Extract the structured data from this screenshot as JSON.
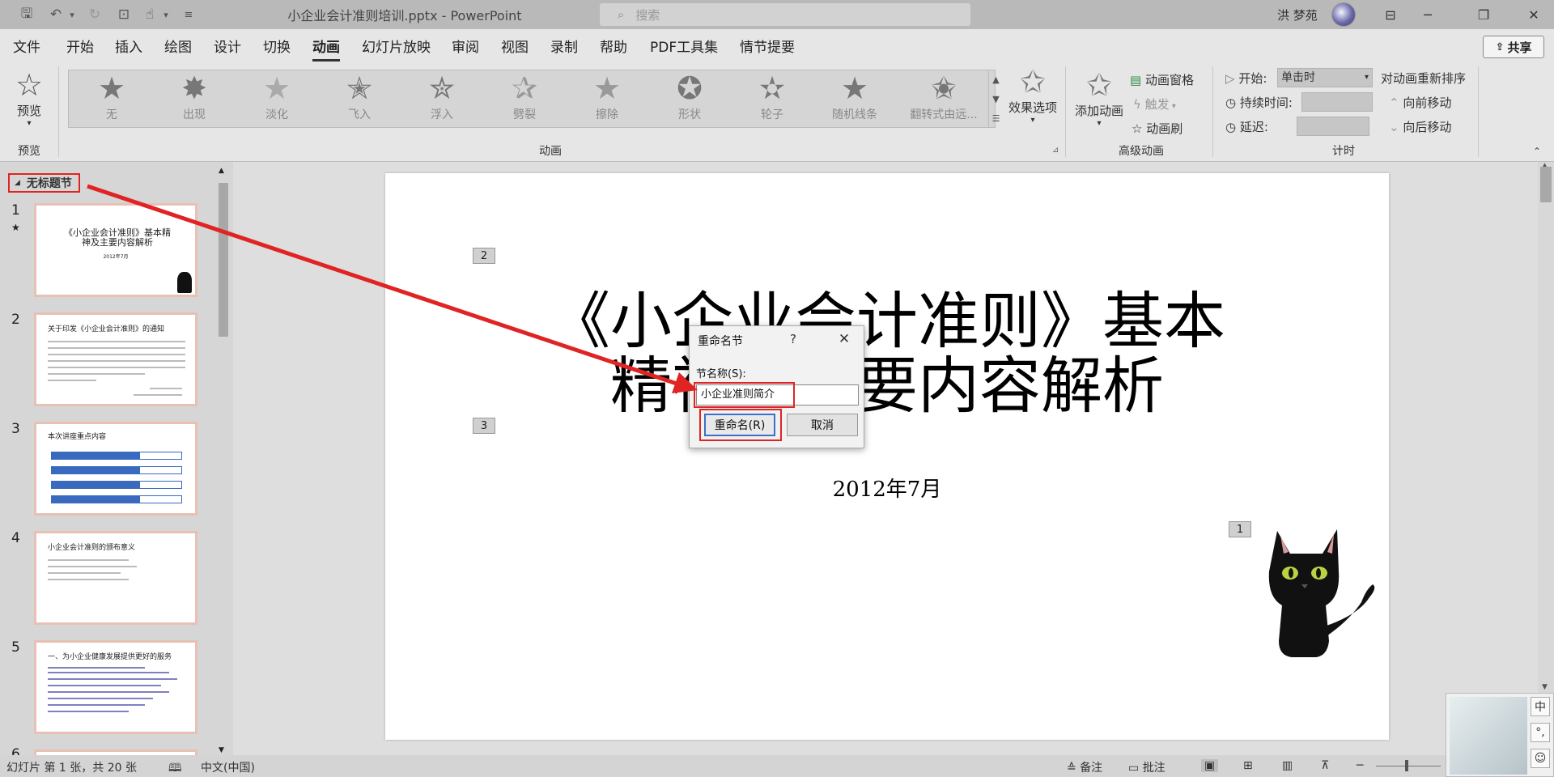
{
  "window": {
    "title": "小企业会计准则培训.pptx  -  PowerPoint",
    "user": "洪 梦苑"
  },
  "search": {
    "placeholder": "搜索"
  },
  "menu": {
    "tabs": [
      "文件",
      "开始",
      "插入",
      "绘图",
      "设计",
      "切换",
      "动画",
      "幻灯片放映",
      "审阅",
      "视图",
      "录制",
      "帮助",
      "PDF工具集",
      "情节提要"
    ],
    "active": "动画",
    "share": "共享"
  },
  "ribbon": {
    "preview": {
      "label": "预览",
      "group": "预览"
    },
    "animations": [
      "无",
      "出现",
      "淡化",
      "飞入",
      "浮入",
      "劈裂",
      "擦除",
      "形状",
      "轮子",
      "随机线条",
      "翻转式由远..."
    ],
    "effect_options": "效果选项",
    "group_animation": "动画",
    "add_animation": "添加动画",
    "animation_pane": "动画窗格",
    "trigger": "触发",
    "animation_painter": "动画刷",
    "group_advanced": "高级动画",
    "start_label": "开始:",
    "start_value": "单击时",
    "duration_label": "持续时间:",
    "delay_label": "延迟:",
    "reorder_label": "对动画重新排序",
    "move_earlier": "向前移动",
    "move_later": "向后移动",
    "group_timing": "计时"
  },
  "panel": {
    "section": "无标题节",
    "thumbs": [
      {
        "num": "1",
        "title": "《小企业会计准则》基本精神及主要内容解析",
        "sub": "2012年7月"
      },
      {
        "num": "2",
        "title": "关于印发《小企业会计准则》的通知"
      },
      {
        "num": "3",
        "title": "本次讲座重点内容"
      },
      {
        "num": "4",
        "title": "小企业会计准则的颁布意义"
      },
      {
        "num": "5",
        "title": "一、为小企业健康发展提供更好的服务"
      },
      {
        "num": "6"
      }
    ]
  },
  "slide": {
    "title_line1": "《小企业会计准则》基本",
    "title_line2": "精神及主要内容解析",
    "subtitle": "2012年7月",
    "tags": [
      "2",
      "3",
      "1"
    ]
  },
  "dialog": {
    "title": "重命名节",
    "help": "?",
    "label": "节名称(S):",
    "value": "小企业准则简介",
    "rename": "重命名(R)",
    "cancel": "取消"
  },
  "status": {
    "slide_info": "幻灯片 第 1 张，共 20 张",
    "language": "中文(中国)",
    "notes": "备注",
    "comments": "批注"
  },
  "ime": {
    "keys": [
      "中",
      "°,",
      "☺"
    ]
  },
  "colors": {
    "accent_red": "#e02424",
    "dialog_focus": "#3c6fc8"
  }
}
